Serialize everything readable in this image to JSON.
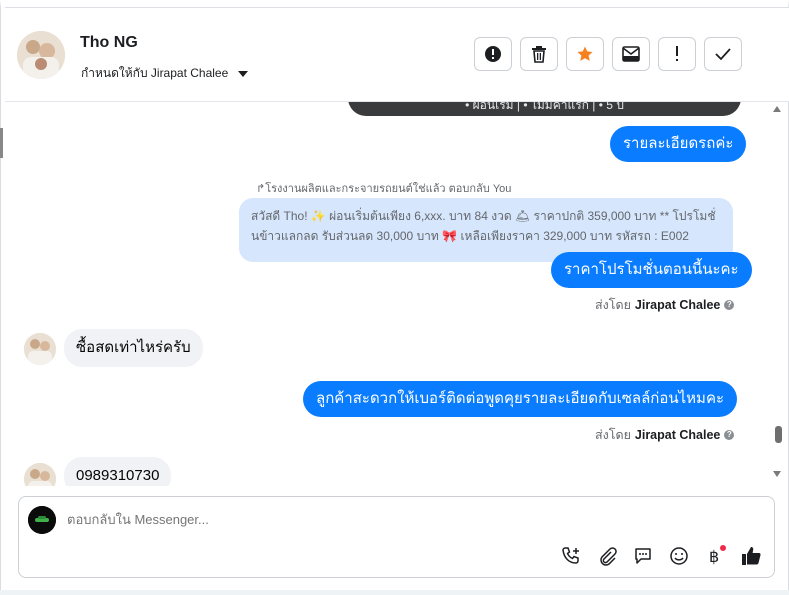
{
  "header": {
    "contact_name": "Tho NG",
    "assigned_to": "กำหนดให้กับ Jirapat Chalee"
  },
  "actions": {
    "spam_icon": "alert-circle-icon",
    "delete_icon": "trash-icon",
    "star_icon": "star-icon",
    "archive_icon": "mail-archive-icon",
    "mark_icon": "exclamation-icon",
    "done_icon": "check-icon",
    "star_color": "#f5821f"
  },
  "chat": {
    "top_partial_text": "• ผ่อนเริ่ม  |  • ไม่มีค่าแรก  |  • 5 ปี",
    "msg1": "รายละเอียดรถค่ะ",
    "reply_meta": "โรงงานผลิตและกระจายรถยนต์ใช่แล้ว ตอบกลับ You",
    "quoted_text": "สวัสดี Tho! ✨ ผ่อนเริ่มต้นเพียง 6,xxx. บาท 84 งวด 🛎 ราคาปกติ 359,000 บาท ** โปรโมชั่นข้าวแลกลด รับส่วนลด 30,000 บาท 🎀 เหลือเพียงราคา 329,000 บาท รหัสรถ : E002",
    "msg2": "ราคาโปรโมชั่นตอนนี้นะคะ",
    "sent_by_label": "ส่งโดย",
    "sent_by_name": "Jirapat Chalee",
    "incoming1": "ซื้อสดเท่าไหร่ครับ",
    "msg3": "ลูกค้าสะดวกให้เบอร์ติดต่อพูดคุยรายละเอียดกับเซลล์ก่อนไหมคะ",
    "incoming2": "0989310730",
    "accent_color": "#0a7cff"
  },
  "composer": {
    "placeholder": "ตอบกลับใน Messenger...",
    "tools": [
      "phone-plus-icon",
      "paperclip-icon",
      "chat-bubble-icon",
      "smiley-icon",
      "baht-icon",
      "thumbs-up-icon"
    ]
  }
}
